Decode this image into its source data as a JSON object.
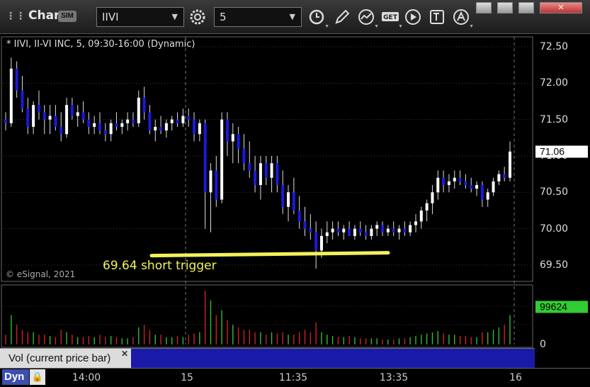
{
  "toolbar": {
    "title": "Chart",
    "sim_badge": "SIM",
    "symbol": "IIVI",
    "interval": "5",
    "icons": [
      "settings-gear-icon",
      "clock-icon",
      "pencil-icon",
      "study-icon",
      "get-icon",
      "play-icon",
      "text-icon",
      "alert-icon"
    ]
  },
  "window_buttons": [
    "minimize",
    "restore",
    "maximize",
    "close"
  ],
  "chart": {
    "status_text": "* IIVI, II-VI INC, 5, 09:30-16:00 (Dynamic)",
    "copyright": "© eSignal, 2021",
    "annotation": "69.64 short trigger",
    "price_label": "71.06",
    "volume_label": "99624",
    "volume_zero": "0",
    "volume_study_label": "Vol (current price bar)",
    "dyn_button": "Dyn",
    "colors": {
      "up": "#ffffff",
      "down": "#1a1ad8",
      "annotation": "#f2f25a",
      "vol_up": "#33bb33",
      "vol_down": "#cc2222"
    }
  },
  "chart_data": {
    "type": "candlestick",
    "y_ticks": [
      "72.50",
      "72.00",
      "71.50",
      "71.00",
      "70.50",
      "70.00",
      "69.50"
    ],
    "ylim": [
      69.4,
      72.6
    ],
    "x_ticks": [
      "14:00",
      "15",
      "11:35",
      "13:35",
      "16"
    ],
    "trigger_level": 69.64,
    "last_price": 71.06,
    "last_volume": 99624,
    "bars": [
      [
        71.5,
        71.6,
        71.35,
        71.45,
        4000
      ],
      [
        71.45,
        72.35,
        71.4,
        72.2,
        12000
      ],
      [
        72.2,
        72.3,
        71.8,
        71.9,
        8000
      ],
      [
        71.9,
        72.1,
        71.6,
        71.65,
        6000
      ],
      [
        71.65,
        71.8,
        71.3,
        71.4,
        5000
      ],
      [
        71.4,
        71.75,
        71.3,
        71.7,
        5000
      ],
      [
        71.7,
        71.9,
        71.5,
        71.6,
        4000
      ],
      [
        71.6,
        71.7,
        71.3,
        71.5,
        4000
      ],
      [
        71.5,
        71.7,
        71.3,
        71.55,
        3500
      ],
      [
        71.55,
        71.7,
        71.35,
        71.4,
        3000
      ],
      [
        71.4,
        71.6,
        71.2,
        71.3,
        6000
      ],
      [
        71.3,
        71.8,
        71.25,
        71.7,
        5000
      ],
      [
        71.7,
        71.8,
        71.5,
        71.55,
        4000
      ],
      [
        71.55,
        71.7,
        71.4,
        71.6,
        3000
      ],
      [
        71.6,
        71.75,
        71.45,
        71.5,
        3000
      ],
      [
        71.5,
        71.6,
        71.3,
        71.4,
        3500
      ],
      [
        71.4,
        71.55,
        71.3,
        71.45,
        3000
      ],
      [
        71.45,
        71.6,
        71.3,
        71.35,
        4000
      ],
      [
        71.35,
        71.45,
        71.2,
        71.3,
        3000
      ],
      [
        71.3,
        71.5,
        71.2,
        71.45,
        3500
      ],
      [
        71.45,
        71.6,
        71.35,
        71.4,
        3000
      ],
      [
        71.4,
        71.5,
        71.3,
        71.45,
        2500
      ],
      [
        71.45,
        71.6,
        71.35,
        71.5,
        2500
      ],
      [
        71.5,
        71.6,
        71.4,
        71.45,
        3000
      ],
      [
        71.45,
        71.9,
        71.4,
        71.8,
        7000
      ],
      [
        71.8,
        71.95,
        71.5,
        71.6,
        8000
      ],
      [
        71.6,
        71.7,
        71.3,
        71.35,
        6000
      ],
      [
        71.35,
        71.5,
        71.2,
        71.4,
        4000
      ],
      [
        71.4,
        71.55,
        71.3,
        71.35,
        4000
      ],
      [
        71.35,
        71.5,
        71.25,
        71.45,
        3000
      ],
      [
        71.45,
        71.55,
        71.35,
        71.5,
        3000
      ],
      [
        71.5,
        71.6,
        71.4,
        71.45,
        3500
      ],
      [
        71.45,
        71.65,
        71.4,
        71.55,
        3000
      ],
      [
        71.55,
        71.65,
        71.4,
        71.5,
        4000
      ],
      [
        71.5,
        71.6,
        71.2,
        71.3,
        4500
      ],
      [
        71.3,
        71.5,
        71.2,
        71.45,
        5000
      ],
      [
        71.45,
        71.5,
        70.0,
        70.5,
        22000
      ],
      [
        70.5,
        70.9,
        69.95,
        70.8,
        18000
      ],
      [
        70.8,
        71.0,
        70.3,
        70.4,
        12000
      ],
      [
        70.4,
        71.6,
        70.35,
        71.5,
        14000
      ],
      [
        71.5,
        71.6,
        71.0,
        71.2,
        10000
      ],
      [
        71.2,
        71.45,
        70.9,
        71.3,
        8000
      ],
      [
        71.3,
        71.4,
        70.9,
        71.1,
        7000
      ],
      [
        71.1,
        71.3,
        70.8,
        70.9,
        6000
      ],
      [
        70.9,
        71.2,
        70.7,
        70.8,
        6000
      ],
      [
        70.8,
        71.0,
        70.5,
        70.6,
        5000
      ],
      [
        70.6,
        71.0,
        70.4,
        70.9,
        5000
      ],
      [
        70.9,
        71.0,
        70.6,
        70.7,
        4000
      ],
      [
        70.7,
        71.0,
        70.5,
        70.9,
        5000
      ],
      [
        70.9,
        71.0,
        70.5,
        70.6,
        4500
      ],
      [
        70.6,
        70.8,
        70.2,
        70.3,
        5000
      ],
      [
        70.3,
        70.6,
        70.1,
        70.5,
        4000
      ],
      [
        70.5,
        70.7,
        70.2,
        70.25,
        4000
      ],
      [
        70.25,
        70.45,
        70.0,
        70.1,
        5000
      ],
      [
        70.1,
        70.3,
        69.9,
        70.0,
        6000
      ],
      [
        70.0,
        70.2,
        69.85,
        69.95,
        5000
      ],
      [
        69.95,
        70.1,
        69.45,
        69.7,
        9000
      ],
      [
        69.7,
        70.0,
        69.6,
        69.9,
        5000
      ],
      [
        69.9,
        70.1,
        69.8,
        69.95,
        4000
      ],
      [
        69.95,
        70.1,
        69.85,
        70.0,
        3500
      ],
      [
        70.0,
        70.1,
        69.9,
        69.95,
        3000
      ],
      [
        69.95,
        70.05,
        69.85,
        70.0,
        3000
      ],
      [
        70.0,
        70.1,
        69.9,
        69.9,
        3500
      ],
      [
        69.9,
        70.05,
        69.85,
        70.0,
        3000
      ],
      [
        70.0,
        70.1,
        69.9,
        69.95,
        2500
      ],
      [
        69.95,
        70.05,
        69.85,
        69.9,
        2500
      ],
      [
        69.9,
        70.05,
        69.85,
        70.0,
        2500
      ],
      [
        70.0,
        70.1,
        69.9,
        70.05,
        2500
      ],
      [
        70.05,
        70.1,
        69.9,
        69.95,
        2000
      ],
      [
        69.95,
        70.05,
        69.9,
        70.0,
        2000
      ],
      [
        70.0,
        70.1,
        69.9,
        69.95,
        2000
      ],
      [
        69.95,
        70.05,
        69.85,
        70.0,
        2500
      ],
      [
        70.0,
        70.1,
        69.9,
        69.95,
        2500
      ],
      [
        69.95,
        70.1,
        69.9,
        70.05,
        3000
      ],
      [
        70.05,
        70.2,
        69.95,
        70.1,
        3500
      ],
      [
        70.1,
        70.3,
        70.0,
        70.25,
        4000
      ],
      [
        70.25,
        70.4,
        70.1,
        70.35,
        4500
      ],
      [
        70.35,
        70.6,
        70.2,
        70.5,
        5000
      ],
      [
        70.5,
        70.8,
        70.4,
        70.7,
        5500
      ],
      [
        70.7,
        70.8,
        70.5,
        70.6,
        4500
      ],
      [
        70.6,
        70.75,
        70.5,
        70.65,
        4000
      ],
      [
        70.65,
        70.8,
        70.55,
        70.7,
        4000
      ],
      [
        70.7,
        70.8,
        70.6,
        70.65,
        3500
      ],
      [
        70.65,
        70.75,
        70.55,
        70.6,
        3500
      ],
      [
        70.6,
        70.7,
        70.5,
        70.55,
        3000
      ],
      [
        70.55,
        70.65,
        70.45,
        70.6,
        3000
      ],
      [
        70.6,
        70.65,
        70.3,
        70.4,
        5000
      ],
      [
        70.4,
        70.55,
        70.3,
        70.5,
        5000
      ],
      [
        70.5,
        70.7,
        70.45,
        70.65,
        6000
      ],
      [
        70.65,
        70.8,
        70.6,
        70.75,
        7000
      ],
      [
        70.75,
        70.85,
        70.65,
        70.7,
        8000
      ],
      [
        70.7,
        71.2,
        70.65,
        71.06,
        12000
      ]
    ]
  }
}
